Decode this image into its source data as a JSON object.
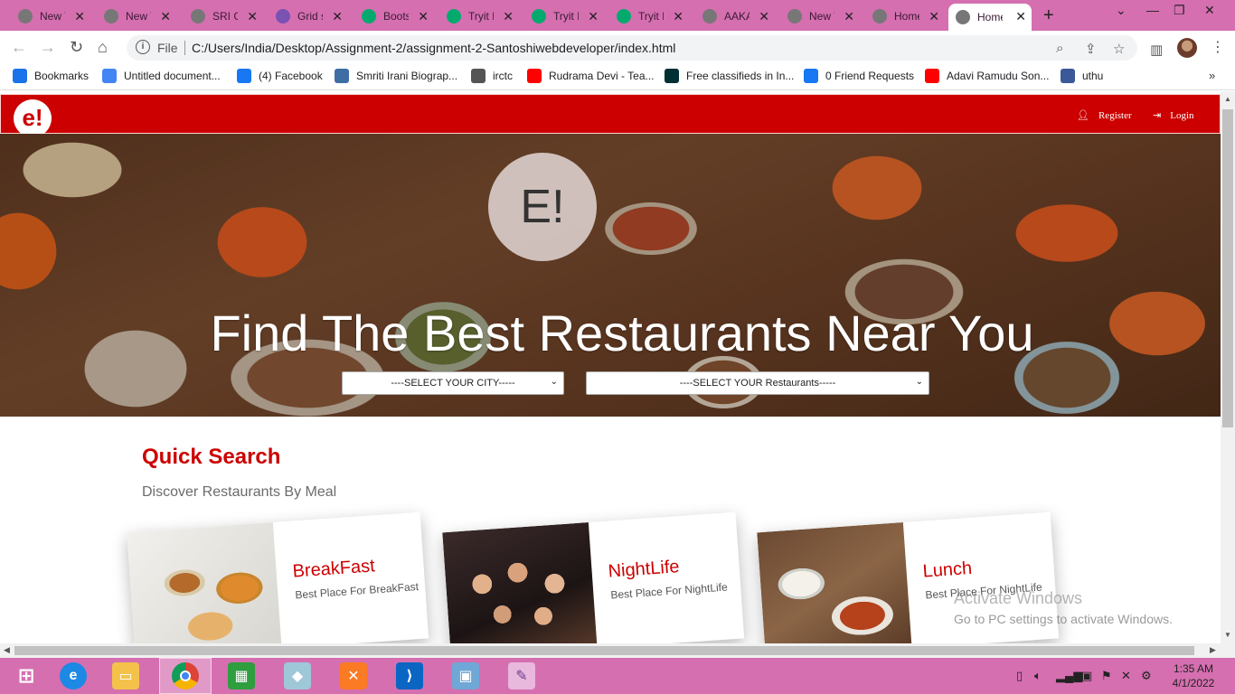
{
  "browser": {
    "tabs": [
      {
        "label": "New Tab",
        "icon": "chrome-icon",
        "color": "#777777"
      },
      {
        "label": "New Tab",
        "icon": "chrome-icon",
        "color": "#777777"
      },
      {
        "label": "SRI GANESH",
        "icon": "globe-icon",
        "color": "#777777"
      },
      {
        "label": "Grid system",
        "icon": "bootstrap-icon",
        "color": "#7952b3"
      },
      {
        "label": "Bootstrap",
        "icon": "tryit-icon",
        "color": "#04aa6d"
      },
      {
        "label": "Tryit Editor",
        "icon": "tryit-icon",
        "color": "#04aa6d"
      },
      {
        "label": "Tryit Editor",
        "icon": "tryit-icon",
        "color": "#04aa6d"
      },
      {
        "label": "Tryit Editor",
        "icon": "tryit-icon",
        "color": "#04aa6d"
      },
      {
        "label": "AAKASH",
        "icon": "globe-icon",
        "color": "#777777"
      },
      {
        "label": "New Tab",
        "icon": "chrome-icon",
        "color": "#777777"
      },
      {
        "label": "Home",
        "icon": "globe-icon",
        "color": "#777777"
      },
      {
        "label": "Home",
        "icon": "globe-icon",
        "color": "#777777",
        "active": true
      }
    ],
    "omnibox": {
      "scheme_label": "File",
      "url": "C:/Users/India/Desktop/Assignment-2/assignment-2-Santoshiwebdeveloper/index.html"
    },
    "bookmarks": [
      {
        "label": "Bookmarks",
        "icon": "star-icon",
        "color": "#1a73e8"
      },
      {
        "label": "Untitled document...",
        "icon": "docs-icon",
        "color": "#4285f4"
      },
      {
        "label": "(4) Facebook",
        "icon": "facebook-icon",
        "color": "#1877f2"
      },
      {
        "label": "Smriti Irani Biograp...",
        "icon": "site-icon",
        "color": "#3f6ea5"
      },
      {
        "label": "irctc",
        "icon": "globe-icon",
        "color": "#555555"
      },
      {
        "label": "Rudrama Devi - Tea...",
        "icon": "youtube-icon",
        "color": "#ff0000"
      },
      {
        "label": "Free classifieds in In...",
        "icon": "olx-icon",
        "color": "#002f34"
      },
      {
        "label": "0 Friend Requests",
        "icon": "facebook-icon",
        "color": "#1877f2"
      },
      {
        "label": "Adavi Ramudu Son...",
        "icon": "youtube-icon",
        "color": "#ff0000"
      },
      {
        "label": "uthu",
        "icon": "facebook-icon",
        "color": "#3b5998"
      }
    ]
  },
  "site": {
    "logo": "e!",
    "nav": {
      "register": "Register",
      "login": "Login"
    },
    "hero": {
      "badge": "E!",
      "title": "Find The Best Restaurants Near You",
      "city_select": "----SELECT YOUR CITY-----",
      "restaurant_select": "----SELECT YOUR Restaurants-----"
    },
    "quick_search": {
      "title": "Quick Search",
      "subtitle": "Discover Restaurants By Meal",
      "cards": [
        {
          "title": "BreakFast",
          "subtitle": "Best Place For BreakFast"
        },
        {
          "title": "NightLife",
          "subtitle": "Best Place For NightLife"
        },
        {
          "title": "Lunch",
          "subtitle": "Best Place For NightLife"
        }
      ]
    }
  },
  "os": {
    "watermark_title": "Activate Windows",
    "watermark_sub": "Go to PC settings to activate Windows.",
    "clock_time": "1:35 AM",
    "clock_date": "4/1/2022"
  },
  "colors": {
    "brand_red": "#cc0000",
    "chrome_pink": "#d56fb0"
  }
}
